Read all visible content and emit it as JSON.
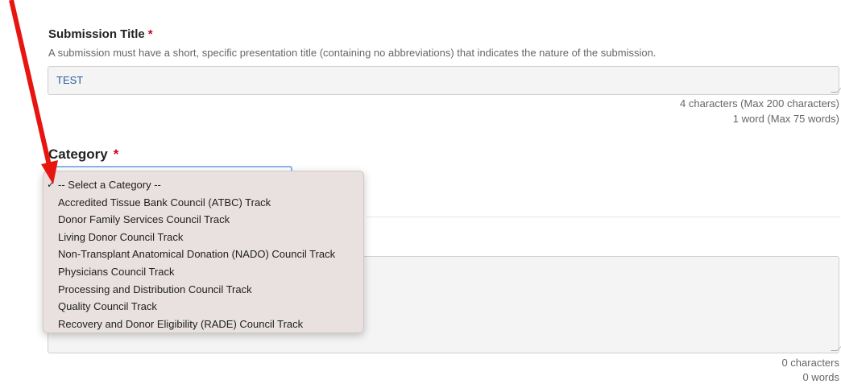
{
  "submission_title": {
    "label": "Submission Title",
    "required_mark": "*",
    "help": "A submission must have a short, specific presentation title (containing no abbreviations) that indicates the nature of the submission.",
    "value": "TEST",
    "char_count": "4 characters (Max 200 characters)",
    "word_count": "1 word (Max 75 words)"
  },
  "category": {
    "label": "Category",
    "required_mark": "*",
    "selected": "-- Select a Category --",
    "check_icon": "✓",
    "options": [
      "-- Select a Category --",
      "Accredited Tissue Bank Council (ATBC) Track",
      "Donor Family Services Council Track",
      "Living Donor Council Track",
      "Non-Transplant Anatomical Donation (NADO) Council Track",
      "Physicians Council Track",
      "Processing and Distribution Council Track",
      "Quality Council Track",
      "Recovery and Donor Eligibility (RADE) Council Track"
    ]
  },
  "abstract": {
    "value": "",
    "char_count": "0 characters",
    "word_count": "0 words"
  },
  "colors": {
    "required": "#d0021b",
    "annotation_arrow": "#e8140f",
    "dropdown_bg": "#e9e1df",
    "input_bg": "#f4f4f4",
    "input_text": "#2a5d9f"
  }
}
